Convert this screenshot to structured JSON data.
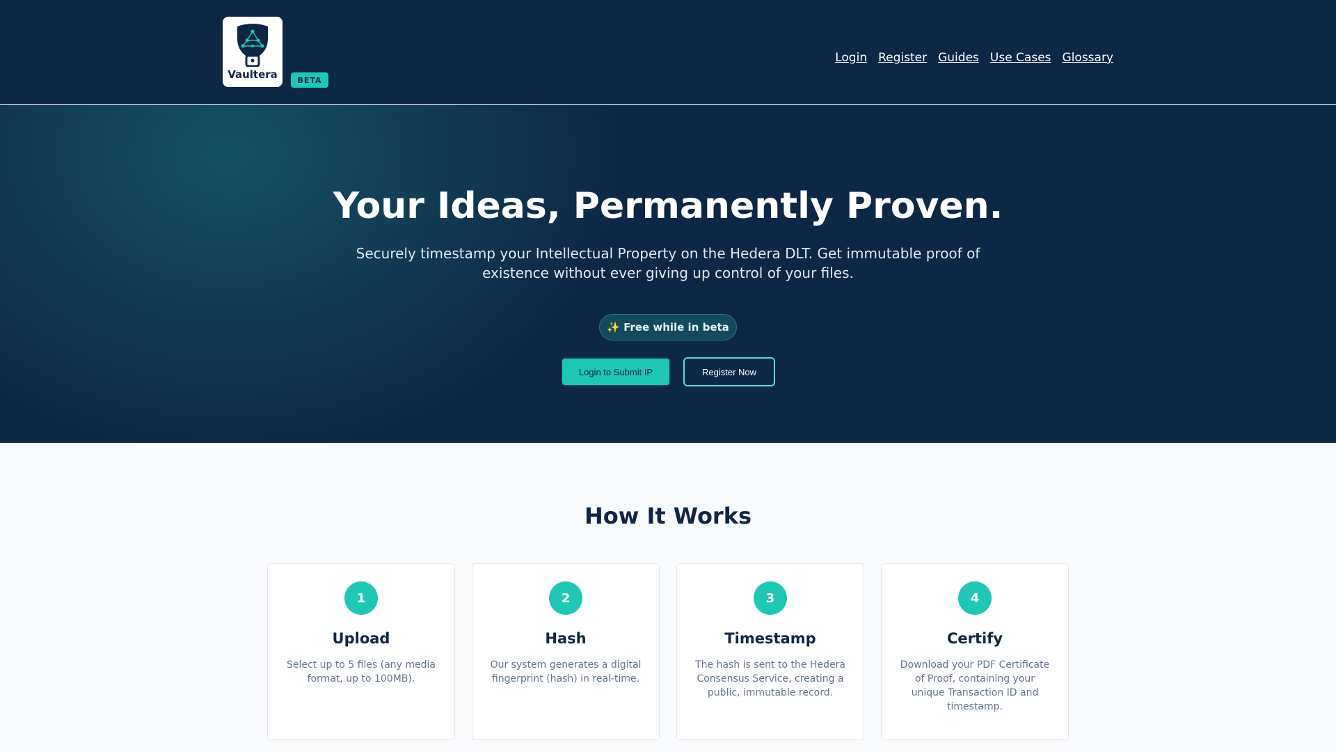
{
  "header": {
    "logo_text": "Vaultera",
    "beta_label": "BETA",
    "nav": [
      {
        "label": "Login"
      },
      {
        "label": "Register"
      },
      {
        "label": "Guides"
      },
      {
        "label": "Use Cases"
      },
      {
        "label": "Glossary"
      }
    ]
  },
  "hero": {
    "title": "Your Ideas, Permanently Proven.",
    "subtitle": "Securely timestamp your Intellectual Property on the Hedera DLT. Get immutable proof of existence without ever giving up control of your files.",
    "pill": "✨ Free while in beta",
    "login_button": "Login to Submit IP",
    "register_button": "Register Now"
  },
  "how": {
    "title": "How It Works",
    "steps": [
      {
        "num": "1",
        "title": "Upload",
        "desc": "Select up to 5 files (any media format, up to 100MB)."
      },
      {
        "num": "2",
        "title": "Hash",
        "desc": "Our system generates a digital fingerprint (hash) in real-time."
      },
      {
        "num": "3",
        "title": "Timestamp",
        "desc": "The hash is sent to the Hedera Consensus Service, creating a public, immutable record."
      },
      {
        "num": "4",
        "title": "Certify",
        "desc": "Download your PDF Certificate of Proof, containing your unique Transaction ID and timestamp."
      }
    ]
  },
  "colors": {
    "navy": "#0d2847",
    "accent": "#1ec8b4",
    "page_bg": "#f8fafc"
  }
}
